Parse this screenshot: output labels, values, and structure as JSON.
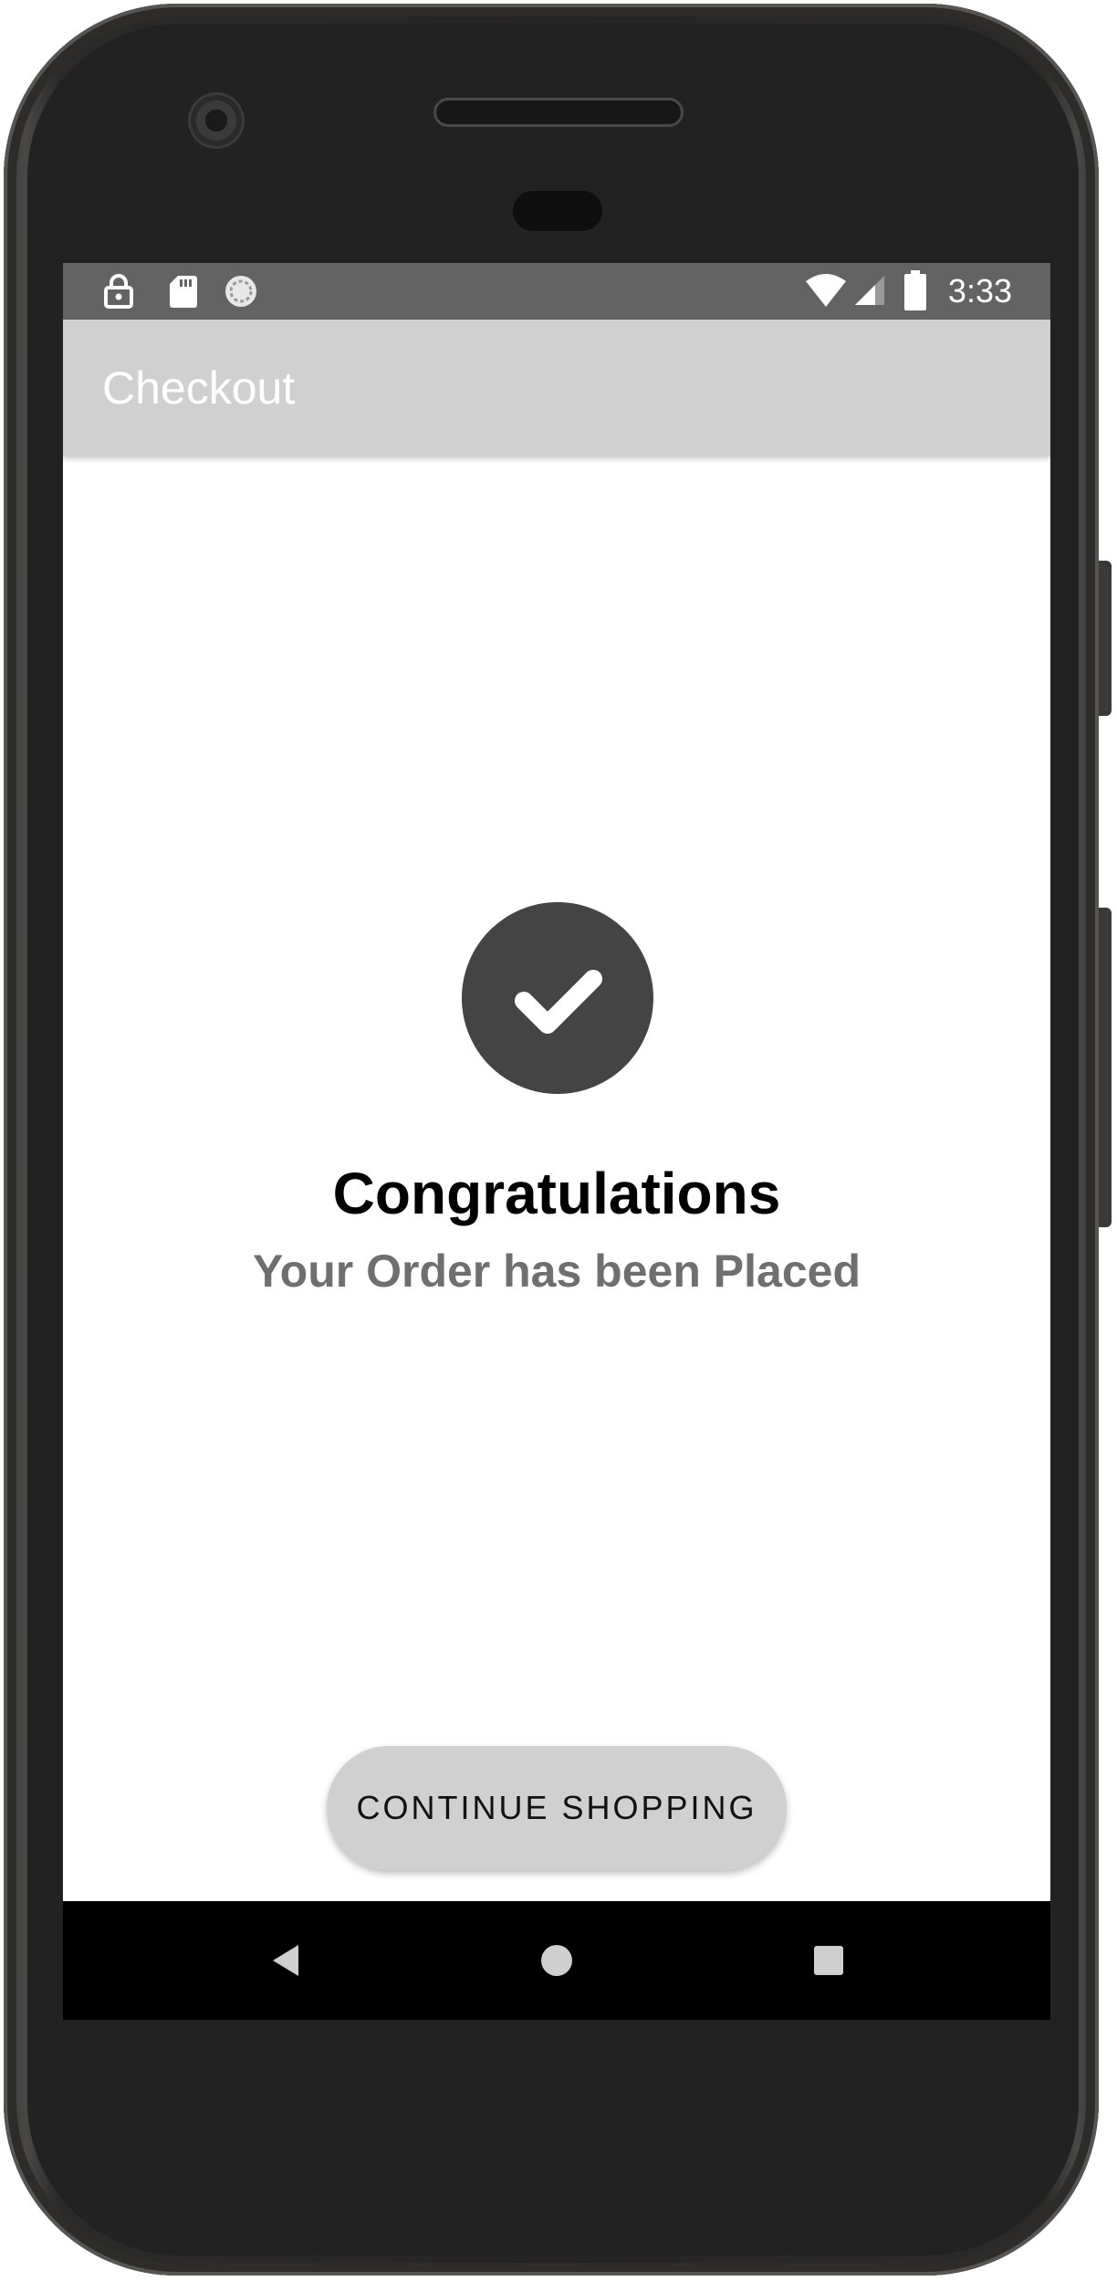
{
  "status_bar": {
    "time": "3:33",
    "left_icons": [
      "lock-icon",
      "sd-card-icon",
      "sync-icon"
    ],
    "right_icons": [
      "wifi-icon",
      "signal-icon",
      "battery-icon"
    ]
  },
  "app_bar": {
    "title": "Checkout"
  },
  "confirmation": {
    "icon": "check-circle-icon",
    "headline": "Congratulations",
    "message": "Your Order has been Placed"
  },
  "actions": {
    "continue_label": "CONTINUE SHOPPING"
  },
  "nav_bar": {
    "icons": [
      "back-icon",
      "home-icon",
      "recents-icon"
    ]
  },
  "colors": {
    "status_bar": "#636363",
    "app_bar": "#d0d0d0",
    "check_circle": "#444444",
    "subtitle": "#6f6f6f",
    "button": "#d0d0d0",
    "device_body": "#232222"
  }
}
